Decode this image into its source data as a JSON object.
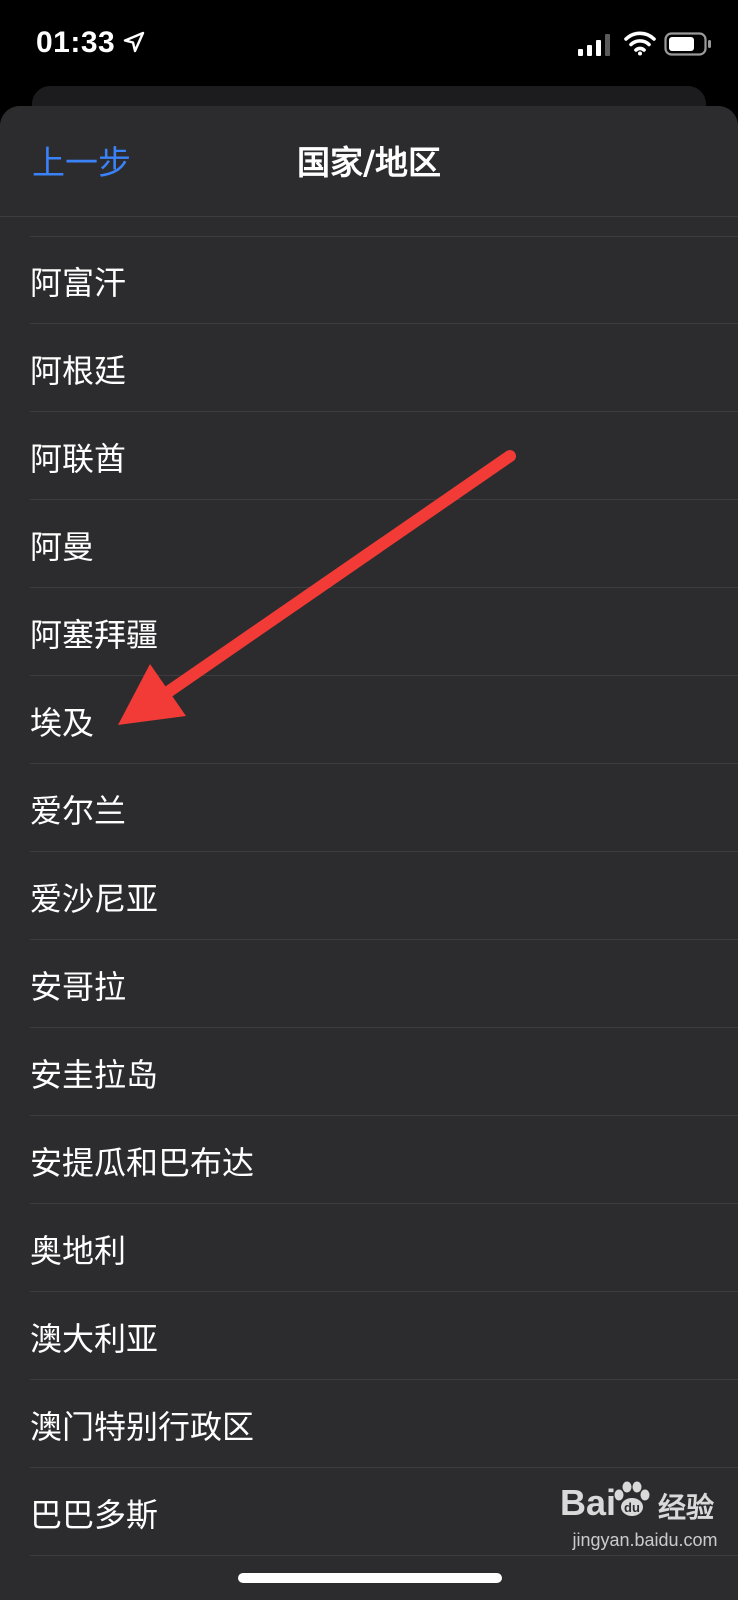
{
  "status_bar": {
    "time": "01:33",
    "icons": [
      "location-arrow-icon",
      "cellular-signal-icon",
      "wifi-icon",
      "battery-icon"
    ]
  },
  "nav": {
    "back_label": "上一步",
    "title": "国家/地区"
  },
  "countries": [
    "阿富汗",
    "阿根廷",
    "阿联酋",
    "阿曼",
    "阿塞拜疆",
    "埃及",
    "爱尔兰",
    "爱沙尼亚",
    "安哥拉",
    "安圭拉岛",
    "安提瓜和巴布达",
    "奥地利",
    "澳大利亚",
    "澳门特别行政区",
    "巴巴多斯"
  ],
  "annotation": {
    "type": "arrow",
    "color": "#f23b36",
    "points_to": "埃及"
  },
  "watermark": {
    "brand": "Bai",
    "brand_cn": "经验",
    "url": "jingyan.baidu.com"
  },
  "colors": {
    "accent": "#3a82f7",
    "sheet_bg": "#2c2c2e",
    "separator": "#3d3d40"
  }
}
